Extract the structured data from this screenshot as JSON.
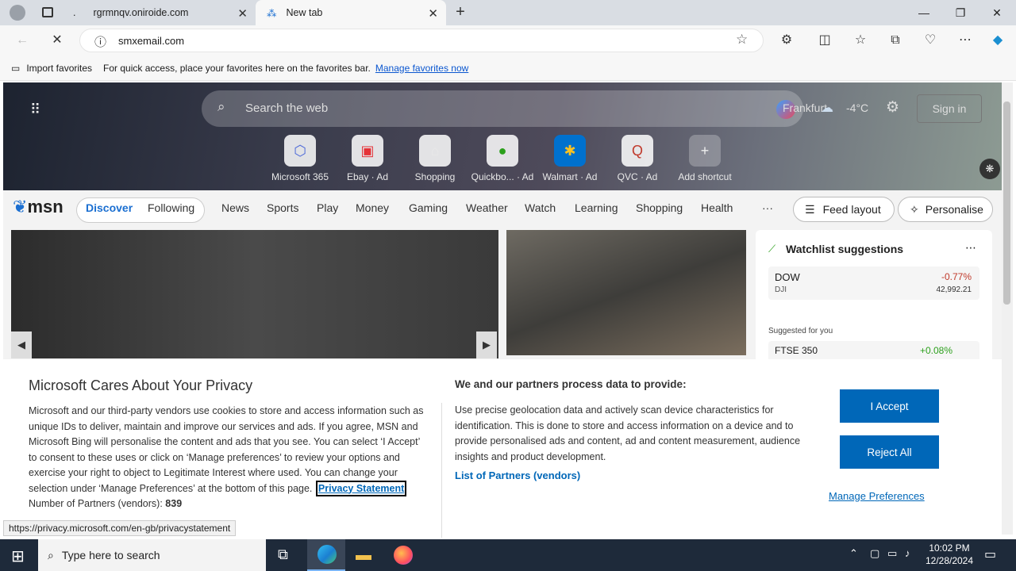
{
  "tabs": [
    {
      "title": "rgrmnqv.oniroide.com",
      "active": false
    },
    {
      "title": "New tab",
      "active": true
    }
  ],
  "address": {
    "url": "smxemail.com"
  },
  "favbar": {
    "import_label": "Import favorites",
    "hint": "For quick access, place your favorites here on the favorites bar.",
    "manage_link": "Manage favorites now"
  },
  "msn": {
    "search_placeholder": "Search the web",
    "location": "Frankfurt",
    "temperature": "-4°C",
    "sign_in": "Sign in",
    "shortcuts": [
      {
        "label": "Microsoft 365",
        "ad": ""
      },
      {
        "label": "Ebay",
        "ad": "Ad"
      },
      {
        "label": "Shopping",
        "ad": ""
      },
      {
        "label": "Quickbo...",
        "ad": "Ad"
      },
      {
        "label": "Walmart",
        "ad": "Ad"
      },
      {
        "label": "QVC",
        "ad": "Ad"
      },
      {
        "label": "Add shortcut",
        "ad": ""
      }
    ],
    "logo": "msn",
    "nav": [
      "Discover",
      "Following",
      "News",
      "Sports",
      "Play",
      "Money",
      "Gaming",
      "Weather",
      "Watch",
      "Learning",
      "Shopping",
      "Health"
    ],
    "more": "···",
    "feed_layout": "Feed layout",
    "personalise": "Personalise",
    "watchlist": {
      "title": "Watchlist suggestions",
      "items": [
        {
          "name": "DOW",
          "sub": "DJI",
          "change": "-0.77%",
          "value": "42,992.21"
        }
      ],
      "suggested_label": "Suggested for you",
      "suggested": [
        {
          "name": "FTSE 350",
          "change": "+0.08%"
        }
      ]
    }
  },
  "privacy": {
    "title": "Microsoft Cares About Your Privacy",
    "body": "Microsoft and our third-party vendors use cookies to store and access information such as unique IDs to deliver, maintain and improve our services and ads. If you agree, MSN and Microsoft Bing will personalise the content and ads that you see. You can select ‘I Accept’ to consent to these uses or click on ‘Manage preferences’ to review your options and exercise your right to object to Legitimate Interest where used.  You can change your selection under ‘Manage Preferences’ at the bottom of this page.",
    "privacy_link": "Privacy Statement",
    "partners_count_label": "Number of Partners (vendors):",
    "partners_count": "839",
    "partners_title": "We and our partners process data to provide:",
    "partners_body": "Use precise geolocation data and actively scan device characteristics for identification. This is done to store and access information on a device and to provide personalised ads and content, ad and content measurement, audience insights and product development.",
    "partners_link": "List of Partners (vendors)",
    "accept": "I Accept",
    "reject": "Reject All",
    "manage": "Manage Preferences"
  },
  "status_url": "https://privacy.microsoft.com/en-gb/privacystatement",
  "taskbar": {
    "search_placeholder": "Type here to search",
    "time": "10:02 PM",
    "date": "12/28/2024"
  }
}
